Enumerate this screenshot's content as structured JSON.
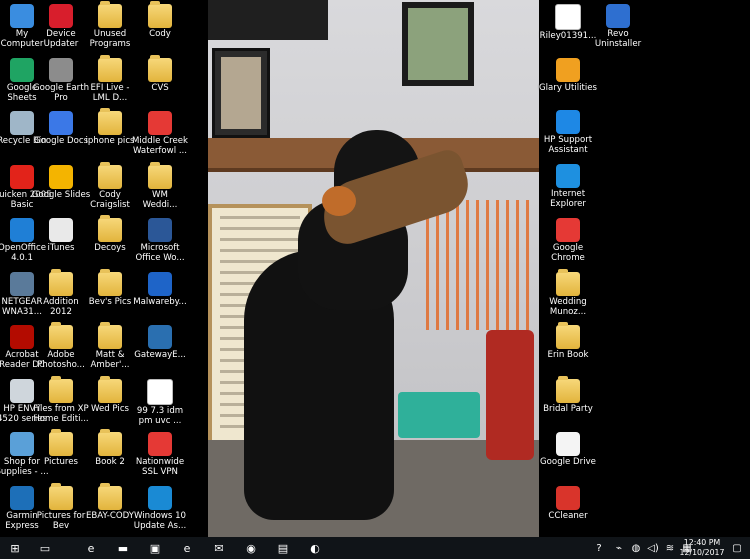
{
  "left_icons": [
    {
      "label": "My\nComputer",
      "icon": "computer-icon",
      "color": "#3a8de0"
    },
    {
      "label": "Device\nUpdater",
      "icon": "device-updater-icon",
      "color": "#d81e2c"
    },
    {
      "label": "Unused\nPrograms",
      "icon": "folder-icon",
      "color": "#e6b84a"
    },
    {
      "label": "Cody",
      "icon": "folder-icon",
      "color": "#e6b84a"
    },
    {
      "label": "Google\nSheets",
      "icon": "google-sheets-icon",
      "color": "#1fa463"
    },
    {
      "label": "Google Earth\nPro",
      "icon": "google-earth-icon",
      "color": "#8c8c8c"
    },
    {
      "label": "EFI Live -\nLML D...",
      "icon": "folder-icon",
      "color": "#e6b84a"
    },
    {
      "label": "CVS",
      "icon": "folder-icon",
      "color": "#e6b84a"
    },
    {
      "label": "Recycle Bin",
      "icon": "recycle-bin-icon",
      "color": "#9fb6c8"
    },
    {
      "label": "Google Docs",
      "icon": "google-docs-icon",
      "color": "#3b78e7"
    },
    {
      "label": "iphone pics",
      "icon": "folder-icon",
      "color": "#e6b84a"
    },
    {
      "label": "Middle Creek\nWaterfowl ...",
      "icon": "chrome-icon",
      "color": "#e53935"
    },
    {
      "label": "Quicken 2005\nBasic",
      "icon": "quicken-icon",
      "color": "#e2231a"
    },
    {
      "label": "Google Slides",
      "icon": "google-slides-icon",
      "color": "#f4b400"
    },
    {
      "label": "Cody\nCraigslist",
      "icon": "folder-icon",
      "color": "#e6b84a"
    },
    {
      "label": "WM\nWeddi...",
      "icon": "folder-icon",
      "color": "#e6b84a"
    },
    {
      "label": "OpenOffice\n4.0.1",
      "icon": "openoffice-icon",
      "color": "#1f7fd6"
    },
    {
      "label": "iTunes",
      "icon": "itunes-icon",
      "color": "#e9e9e9"
    },
    {
      "label": "Decoys",
      "icon": "folder-icon",
      "color": "#e6b84a"
    },
    {
      "label": "Microsoft\nOffice Wo...",
      "icon": "word-icon",
      "color": "#2b5797"
    },
    {
      "label": "NETGEAR\nWNA31...",
      "icon": "netgear-icon",
      "color": "#5a7a9a"
    },
    {
      "label": "Addition\n2012",
      "icon": "folder-icon",
      "color": "#e6b84a"
    },
    {
      "label": "Bev's Pics",
      "icon": "folder-icon",
      "color": "#e6b84a"
    },
    {
      "label": "Malwareby...",
      "icon": "malwarebytes-icon",
      "color": "#1e64c8"
    },
    {
      "label": "Acrobat\nReader DC",
      "icon": "acrobat-icon",
      "color": "#b30b00"
    },
    {
      "label": "Adobe\nPhotosho...",
      "icon": "folder-icon",
      "color": "#e6b84a"
    },
    {
      "label": "Matt &\nAmber'...",
      "icon": "folder-icon",
      "color": "#e6b84a"
    },
    {
      "label": "GatewayE...",
      "icon": "gateway-icon",
      "color": "#2a6fb0"
    },
    {
      "label": "HP ENVY\n4520 series",
      "icon": "printer-icon",
      "color": "#cfd6dc"
    },
    {
      "label": "Files from XP\nHome Editi...",
      "icon": "folder-icon",
      "color": "#e6b84a"
    },
    {
      "label": "Wed Pics",
      "icon": "folder-icon",
      "color": "#e6b84a"
    },
    {
      "label": "99 7.3 idm\npm uvc ...",
      "icon": "document-icon",
      "color": "#f2f2f2"
    },
    {
      "label": "Shop for\nSupplies - ...",
      "icon": "shop-supplies-icon",
      "color": "#5aa0d8"
    },
    {
      "label": "Pictures",
      "icon": "folder-icon",
      "color": "#e6b84a"
    },
    {
      "label": "Book 2",
      "icon": "folder-icon",
      "color": "#e6b84a"
    },
    {
      "label": "Nationwide\nSSL VPN",
      "icon": "chrome-icon",
      "color": "#e53935"
    },
    {
      "label": "Garmin\nExpress",
      "icon": "garmin-icon",
      "color": "#1d6fb8"
    },
    {
      "label": "Pictures for\nBev",
      "icon": "folder-icon",
      "color": "#e6b84a"
    },
    {
      "label": "EBAY-CODY",
      "icon": "folder-icon",
      "color": "#e6b84a"
    },
    {
      "label": "Windows 10\nUpdate As...",
      "icon": "windows-icon",
      "color": "#1a8ad4"
    }
  ],
  "right_icons": [
    {
      "label": "Riley01391...",
      "icon": "document-icon",
      "color": "#e8e8e8"
    },
    {
      "label": "Revo\nUninstaller",
      "icon": "revo-uninstaller-icon",
      "color": "#2e6fd0"
    },
    {
      "label": "Glary Utilities",
      "icon": "glary-utilities-icon",
      "color": "#f0a020"
    },
    {
      "label": "HP Support\nAssistant",
      "icon": "help-icon",
      "color": "#1e88e5"
    },
    {
      "label": "Internet\nExplorer",
      "icon": "internet-explorer-icon",
      "color": "#1e90e0"
    },
    {
      "label": "Google\nChrome",
      "icon": "chrome-icon",
      "color": "#e53935"
    },
    {
      "label": "Wedding\nMunoz...",
      "icon": "folder-icon",
      "color": "#e6b84a"
    },
    {
      "label": "Erin Book",
      "icon": "folder-icon",
      "color": "#e6b84a"
    },
    {
      "label": "Bridal Party",
      "icon": "folder-icon",
      "color": "#e6b84a"
    },
    {
      "label": "Google Drive",
      "icon": "google-drive-icon",
      "color": "#f4f4f4"
    },
    {
      "label": "CCleaner",
      "icon": "ccleaner-icon",
      "color": "#d9342b"
    }
  ],
  "taskbar": {
    "buttons": [
      {
        "name": "start-button",
        "icon": "windows-logo-icon",
        "glyph": "⊞"
      },
      {
        "name": "task-view-button",
        "icon": "task-view-icon",
        "glyph": "▭"
      },
      {
        "name": "edge-button",
        "icon": "edge-icon",
        "glyph": "e"
      },
      {
        "name": "file-explorer-button",
        "icon": "folder-icon",
        "glyph": "▬"
      },
      {
        "name": "store-button",
        "icon": "store-icon",
        "glyph": "▣"
      },
      {
        "name": "internet-explorer-button",
        "icon": "internet-explorer-icon",
        "glyph": "e"
      },
      {
        "name": "mail-button",
        "icon": "mail-icon",
        "glyph": "✉"
      },
      {
        "name": "chrome-button",
        "icon": "chrome-icon",
        "glyph": "◉"
      },
      {
        "name": "remote-desktop-button",
        "icon": "remote-desktop-icon",
        "glyph": "▤"
      },
      {
        "name": "paint-button",
        "icon": "paint-icon",
        "glyph": "◐"
      }
    ],
    "tray": [
      {
        "name": "help-tray-icon",
        "glyph": "?"
      },
      {
        "name": "usb-tray-icon",
        "glyph": "⌁"
      },
      {
        "name": "network-tray-icon",
        "glyph": "◍"
      },
      {
        "name": "volume-tray-icon",
        "glyph": "◁)"
      },
      {
        "name": "wifi-tray-icon",
        "glyph": "≋"
      },
      {
        "name": "keyboard-tray-icon",
        "glyph": "▦"
      }
    ],
    "time": "12:40 PM",
    "date": "12/10/2017",
    "notification_glyph": "▢"
  }
}
